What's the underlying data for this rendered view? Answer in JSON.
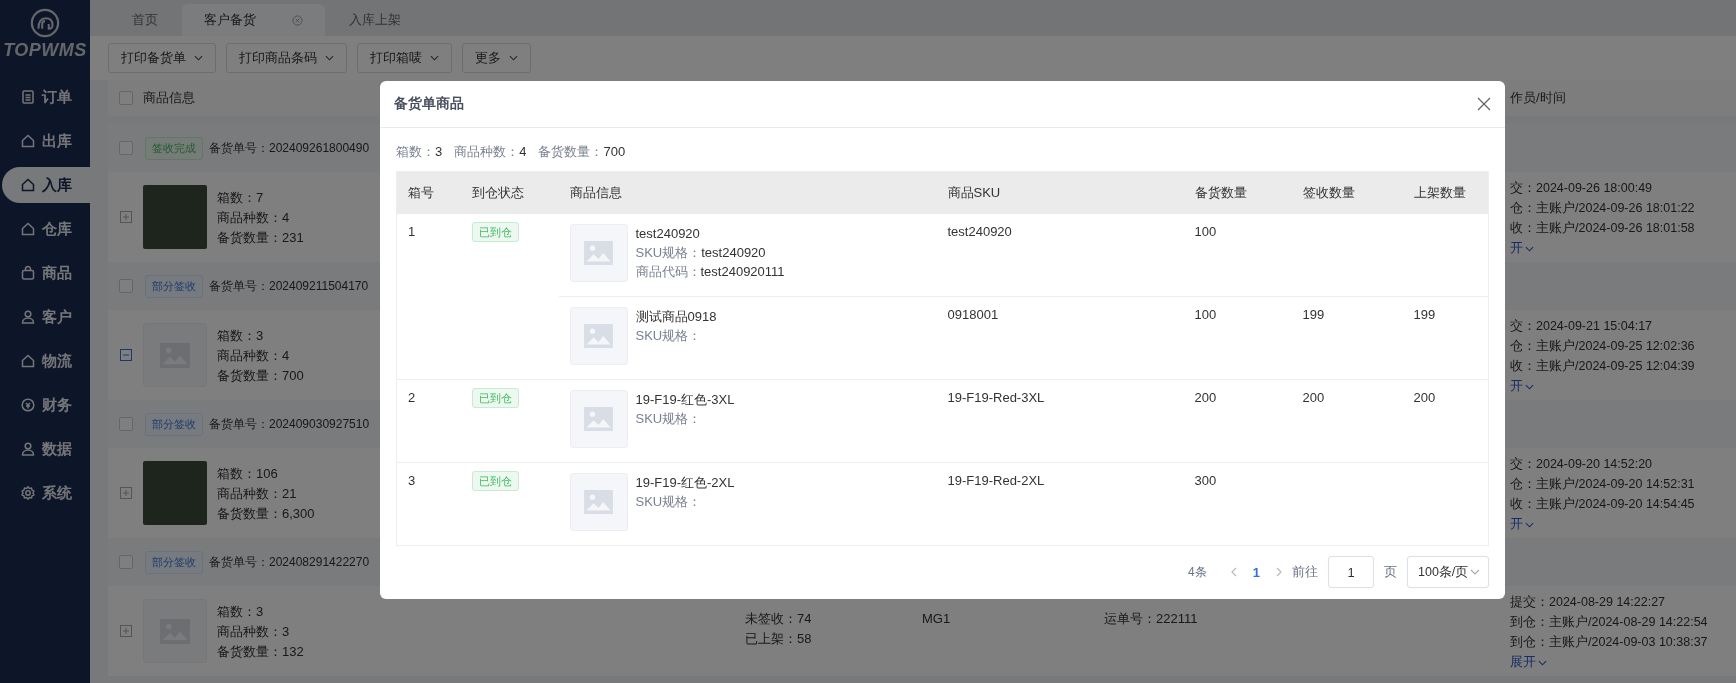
{
  "sidebar": {
    "logo": "TOPWMS",
    "items": [
      {
        "label": "订单",
        "selected": false
      },
      {
        "label": "出库",
        "selected": false
      },
      {
        "label": "入库",
        "selected": true
      },
      {
        "label": "仓库",
        "selected": false
      },
      {
        "label": "商品",
        "selected": false
      },
      {
        "label": "客户",
        "selected": false
      },
      {
        "label": "物流",
        "selected": false
      },
      {
        "label": "财务",
        "selected": false
      },
      {
        "label": "数据",
        "selected": false
      },
      {
        "label": "系统",
        "selected": false
      }
    ]
  },
  "tabs": [
    {
      "label": "首页",
      "selected": false,
      "closable": false
    },
    {
      "label": "客户备货",
      "selected": true,
      "closable": true
    },
    {
      "label": "入库上架",
      "selected": false,
      "closable": false
    }
  ],
  "toolbar": [
    "打印备货单",
    "打印商品条码",
    "打印箱唛",
    "更多"
  ],
  "list": {
    "header_checked": false,
    "product_header": "商品信息",
    "time_header": "作员/时间",
    "groups": [
      {
        "status": {
          "label": "签收完成",
          "kind": "complete"
        },
        "order_no": "备货单号：202409261800490",
        "checked": false,
        "expanded": false,
        "has_photo": true,
        "stats": [
          "箱数：7",
          "商品种数：4",
          "备货数量：231"
        ],
        "times": [
          "交：2024-09-26 18:00:49",
          "仓：主账户/2024-09-26 18:01:22",
          "收：主账户/2024-09-26 18:01:58"
        ],
        "toggle": "开"
      },
      {
        "status": {
          "label": "部分签收",
          "kind": "partial"
        },
        "order_no": "备货单号：202409211504170",
        "checked": false,
        "expanded": true,
        "has_photo": false,
        "stats": [
          "箱数：3",
          "商品种数：4",
          "备货数量：700"
        ],
        "times": [
          "交：2024-09-21 15:04:17",
          "仓：主账户/2024-09-25 12:02:36",
          "收：主账户/2024-09-25 12:04:39"
        ],
        "toggle": "开"
      },
      {
        "status": {
          "label": "部分签收",
          "kind": "partial"
        },
        "order_no": "备货单号：202409030927510",
        "checked": false,
        "expanded": false,
        "has_photo": true,
        "stats": [
          "箱数：106",
          "商品种数：21",
          "备货数量：6,300"
        ],
        "times": [
          "交：2024-09-20 14:52:20",
          "仓：主账户/2024-09-20 14:52:31",
          "收：主账户/2024-09-20 14:54:45"
        ],
        "toggle": "开"
      },
      {
        "status": {
          "label": "部分签收",
          "kind": "partial"
        },
        "order_no": "备货单号：202408291422270",
        "checked": false,
        "expanded": false,
        "has_photo": false,
        "stats": [
          "箱数：3",
          "商品种数：3",
          "备货数量：132"
        ],
        "columns": [
          [
            "未签收：74",
            "已上架：58"
          ],
          [
            "MG1"
          ],
          [
            "运单号：222111"
          ]
        ],
        "times": [
          "提交：2024-08-29 14:22:27",
          "到仓：主账户/2024-08-29 14:22:54",
          "到仓：主账户/2024-09-03 10:38:37"
        ],
        "toggle": "展开"
      }
    ]
  },
  "modal": {
    "title": "备货单商品",
    "summary": [
      {
        "label": "箱数：",
        "value": "3"
      },
      {
        "label": "商品种数：",
        "value": "4"
      },
      {
        "label": "备货数量：",
        "value": "700"
      }
    ],
    "columns": [
      "箱号",
      "到仓状态",
      "商品信息",
      "商品SKU",
      "备货数量",
      "签收数量",
      "上架数量"
    ],
    "boxes": [
      {
        "box_no": "1",
        "status": {
          "label": "已到仓",
          "kind": "arrived"
        },
        "items": [
          {
            "name": "test240920",
            "details": [
              {
                "label": "SKU规格：",
                "value": "test240920"
              },
              {
                "label": "商品代码：",
                "value": "test240920111"
              }
            ],
            "sku": "test240920",
            "stock_qty": "100"
          },
          {
            "name": "测试商品0918",
            "details": [
              {
                "label": "SKU规格："
              }
            ],
            "sku": "0918001",
            "stock_qty": "100",
            "received_qty": "199",
            "shelved_qty": "199"
          }
        ]
      },
      {
        "box_no": "2",
        "status": {
          "label": "已到仓",
          "kind": "arrived"
        },
        "items": [
          {
            "name": "19-F19-红色-3XL",
            "details": [
              {
                "label": "SKU规格："
              }
            ],
            "sku": "19-F19-Red-3XL",
            "stock_qty": "200",
            "received_qty": "200",
            "shelved_qty": "200"
          }
        ]
      },
      {
        "box_no": "3",
        "status": {
          "label": "已到仓",
          "kind": "arrived"
        },
        "items": [
          {
            "name": "19-F19-红色-2XL",
            "details": [
              {
                "label": "SKU规格："
              }
            ],
            "sku": "19-F19-Red-2XL",
            "stock_qty": "300"
          }
        ]
      }
    ],
    "pagination": {
      "total": "4条",
      "pages": [
        {
          "label": "1",
          "selected": true
        }
      ],
      "goto_label": "前往",
      "goto_value": "1",
      "page_unit": "页",
      "page_size": "100条/页"
    }
  }
}
